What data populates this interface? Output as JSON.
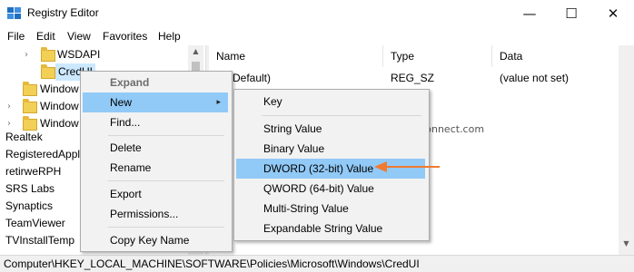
{
  "window": {
    "title": "Registry Editor"
  },
  "window_controls": {
    "minimize": "—",
    "maximize": "☐",
    "close": "✕"
  },
  "menubar": [
    "File",
    "Edit",
    "View",
    "Favorites",
    "Help"
  ],
  "tree": {
    "items": [
      {
        "label": "WSDAPI",
        "folder": true,
        "expander": "›"
      },
      {
        "label": "CredUI",
        "folder": true,
        "expander": "",
        "selected": true
      },
      {
        "label": "Window",
        "folder": true,
        "expander": ""
      },
      {
        "label": "Window",
        "folder": true,
        "expander": "›"
      },
      {
        "label": "Window",
        "folder": true,
        "expander": "›"
      },
      {
        "label": "Realtek",
        "folder": false
      },
      {
        "label": "RegisteredAppl",
        "folder": false
      },
      {
        "label": "retirweRPH",
        "folder": false
      },
      {
        "label": "SRS Labs",
        "folder": false
      },
      {
        "label": "Synaptics",
        "folder": false
      },
      {
        "label": "TeamViewer",
        "folder": false
      },
      {
        "label": "TVInstallTemp",
        "folder": false
      }
    ]
  },
  "list": {
    "columns": [
      "Name",
      "Type",
      "Data"
    ],
    "rows": [
      {
        "name": "(Default)",
        "type": "REG_SZ",
        "data": "(value not set)"
      }
    ]
  },
  "context_menu": {
    "items": [
      {
        "label": "Expand",
        "disabled": true
      },
      {
        "label": "New",
        "submenu": true,
        "highlighted": true
      },
      {
        "label": "Find..."
      },
      {
        "separator": true
      },
      {
        "label": "Delete"
      },
      {
        "label": "Rename"
      },
      {
        "separator": true
      },
      {
        "label": "Export"
      },
      {
        "label": "Permissions..."
      },
      {
        "separator": true
      },
      {
        "label": "Copy Key Name"
      }
    ]
  },
  "submenu": {
    "items": [
      {
        "label": "Key"
      },
      {
        "separator": true
      },
      {
        "label": "String Value"
      },
      {
        "label": "Binary Value"
      },
      {
        "label": "DWORD (32-bit) Value",
        "highlighted": true
      },
      {
        "label": "QWORD (64-bit) Value"
      },
      {
        "label": "Multi-String Value"
      },
      {
        "label": "Expandable String Value"
      }
    ]
  },
  "watermark": "©Howto-connect.com",
  "status_bar": {
    "path": "Computer\\HKEY_LOCAL_MACHINE\\SOFTWARE\\Policies\\Microsoft\\Windows\\CredUI"
  },
  "colors": {
    "highlight": "#91c9f7",
    "tree_selection": "#cce8ff",
    "arrow": "#f07a30",
    "folder": "#f2cf55"
  },
  "icons": {
    "app": "registry-editor-icon",
    "submenu_arrow": "▸",
    "scroll_up": "▲",
    "scroll_down": "▼"
  }
}
